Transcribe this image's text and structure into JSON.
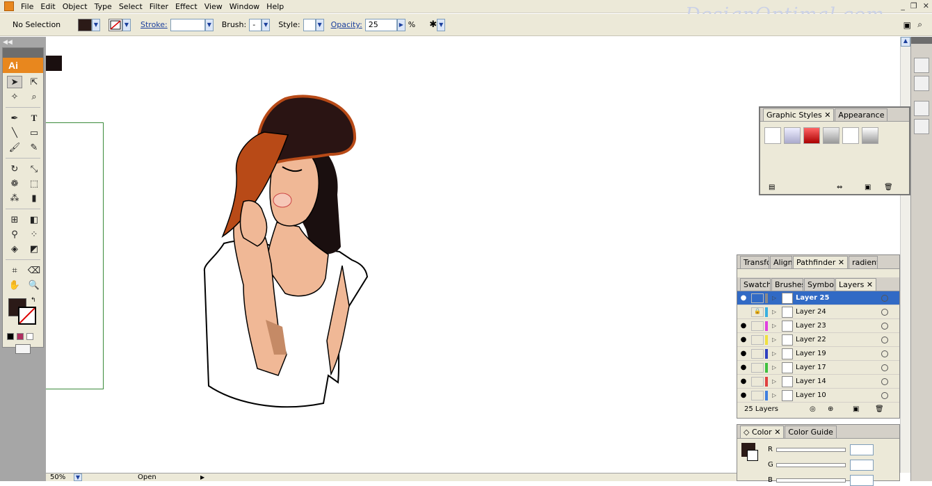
{
  "menubar": {
    "items": [
      "File",
      "Edit",
      "Object",
      "Type",
      "Select",
      "Filter",
      "Effect",
      "View",
      "Window",
      "Help"
    ],
    "window_controls": [
      "_",
      "❐",
      "✕"
    ]
  },
  "watermark": "DesignOptimal.com",
  "controlbar": {
    "selection": "No Selection",
    "stroke_label": "Stroke:",
    "brush_label": "Brush:",
    "brush_value": "-",
    "style_label": "Style:",
    "opacity_label": "Opacity:",
    "opacity_value": "25",
    "opacity_unit": "%"
  },
  "tools": {
    "badge": "Ai"
  },
  "status": {
    "zoom": "50%",
    "state": "Open"
  },
  "graphic_styles": {
    "tabs": [
      "Graphic Styles",
      "Appearance"
    ]
  },
  "layers_panel": {
    "tabs_top": [
      "Transfo",
      "Align",
      "Pathfinder",
      "radient"
    ],
    "tabs": [
      "Swatche",
      "Brushes",
      "Symbols",
      "Layers"
    ],
    "layers": [
      {
        "name": "Layer 25",
        "color": "#8a8a8a",
        "eye": "●",
        "lock": ""
      },
      {
        "name": "Layer 24",
        "color": "#3ab0e0",
        "eye": "",
        "lock": "🔒"
      },
      {
        "name": "Layer 23",
        "color": "#e040e0",
        "eye": "●",
        "lock": ""
      },
      {
        "name": "Layer 22",
        "color": "#f0e040",
        "eye": "●",
        "lock": ""
      },
      {
        "name": "Layer 19",
        "color": "#3040c0",
        "eye": "●",
        "lock": ""
      },
      {
        "name": "Layer 17",
        "color": "#40c040",
        "eye": "●",
        "lock": ""
      },
      {
        "name": "Layer 14",
        "color": "#e04040",
        "eye": "●",
        "lock": ""
      },
      {
        "name": "Layer 10",
        "color": "#4080e0",
        "eye": "●",
        "lock": ""
      }
    ],
    "count": "25 Layers"
  },
  "color_panel": {
    "tabs": [
      "Color",
      "Color Guide"
    ],
    "r_label": "R",
    "g_label": "G",
    "b_label": "B"
  },
  "colors": {
    "ui_bg": "#ece9d8",
    "selection": "#316ac5",
    "accent": "#e8871e",
    "hat": "#b84a17",
    "skin": "#f0b896",
    "hair": "#1a0f0f"
  }
}
